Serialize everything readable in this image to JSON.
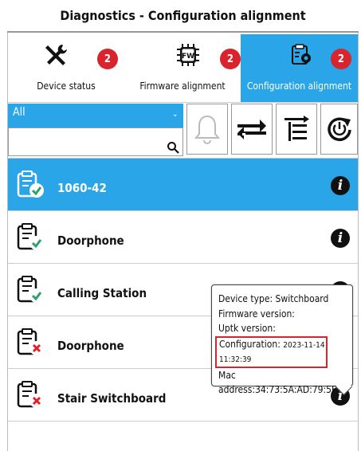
{
  "window": {
    "title": "Diagnostics - Configuration alignment"
  },
  "tabs": [
    {
      "label": "Device status",
      "badge": "2",
      "icon": "tools-icon"
    },
    {
      "label": "Firmware alignment",
      "badge": "2",
      "icon": "firmware-chip-icon",
      "chip_text": "FW"
    },
    {
      "label": "Configuration alignment",
      "badge": "2",
      "icon": "config-gear-icon"
    }
  ],
  "toolbar": {
    "filter_value": "All",
    "search_value": "",
    "icons": [
      "bell-icon",
      "sync-arrows-icon",
      "list-align-icon",
      "power-refresh-icon"
    ]
  },
  "devices": [
    {
      "name": "1060-42",
      "status": "aligned"
    },
    {
      "name": "Doorphone",
      "status": "aligned"
    },
    {
      "name": "Calling Station",
      "status": "aligned"
    },
    {
      "name": "Doorphone",
      "status": "misaligned"
    },
    {
      "name": "Stair Switchboard",
      "status": "misaligned"
    }
  ],
  "tooltip": {
    "device_type": "Device type: Switchboard",
    "firmware": "Firmware version:",
    "uptk": "Uptk version:",
    "config_label": "Configuration:",
    "config_date": "2023-11-14 11:32:39",
    "mac": "Mac address:34:73:5A:AD:79:5F"
  },
  "colors": {
    "accent": "#2aa6e8",
    "badge": "#d9232d"
  }
}
